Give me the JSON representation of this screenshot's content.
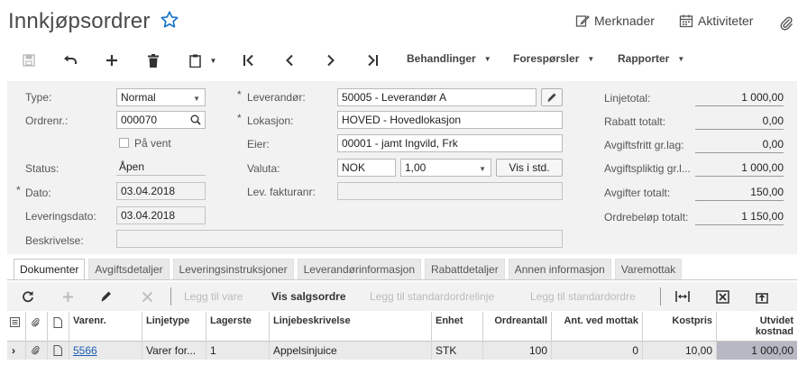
{
  "header": {
    "title": "Innkjøpsordrer",
    "notes_label": "Merknader",
    "activities_label": "Aktiviteter"
  },
  "toolbar": {
    "menus": [
      "Behandlinger",
      "Forespørsler",
      "Rapporter"
    ]
  },
  "form": {
    "type_label": "Type:",
    "type_value": "Normal",
    "order_no_label": "Ordrenr.:",
    "order_no_value": "000070",
    "on_hold_label": "På vent",
    "status_label": "Status:",
    "status_value": "Åpen",
    "date_label": "Dato:",
    "date_value": "03.04.2018",
    "delivery_date_label": "Leveringsdato:",
    "delivery_date_value": "03.04.2018",
    "description_label": "Beskrivelse:",
    "description_value": "",
    "supplier_label": "Leverandør:",
    "supplier_value": "50005 - Leverandør A",
    "location_label": "Lokasjon:",
    "location_value": "HOVED - Hovedlokasjon",
    "owner_label": "Eier:",
    "owner_value": "00001 - jamt Ingvild, Frk",
    "currency_label": "Valuta:",
    "currency_code": "NOK",
    "currency_rate": "1,00",
    "currency_button": "Vis i std.",
    "supplier_invoice_label": "Lev. fakturanr:",
    "supplier_invoice_value": ""
  },
  "summary": [
    {
      "label": "Linjetotal:",
      "value": "1 000,00"
    },
    {
      "label": "Rabatt totalt:",
      "value": "0,00"
    },
    {
      "label": "Avgiftsfritt gr.lag:",
      "value": "0,00"
    },
    {
      "label": "Avgiftspliktig gr.l...",
      "value": "1 000,00"
    },
    {
      "label": "Avgifter totalt:",
      "value": "150,00"
    },
    {
      "label": "Ordrebeløp totalt:",
      "value": "1 150,00"
    }
  ],
  "tabs": [
    "Dokumenter",
    "Avgiftsdetaljer",
    "Leveringsinstruksjoner",
    "Leverandørinformasjon",
    "Rabattdetaljer",
    "Annen informasjon",
    "Varemottak"
  ],
  "grid_toolbar": {
    "add_line": "Legg til vare",
    "show_sales_order": "Vis salgsordre",
    "add_standard_order_line": "Legg til standardordrelinje",
    "add_standard_order": "Legg til standardordre"
  },
  "grid": {
    "columns": [
      "Varenr.",
      "Linjetype",
      "Lagerste",
      "Linjebeskrivelse",
      "Enhet",
      "Ordreantall",
      "Ant. ved mottak",
      "Kostpris",
      "Utvidet kostnad"
    ],
    "rows": [
      [
        "5566",
        "Varer for...",
        "1",
        "Appelsinjuice",
        "STK",
        "100",
        "0",
        "10,00",
        "1 000,00"
      ]
    ]
  }
}
